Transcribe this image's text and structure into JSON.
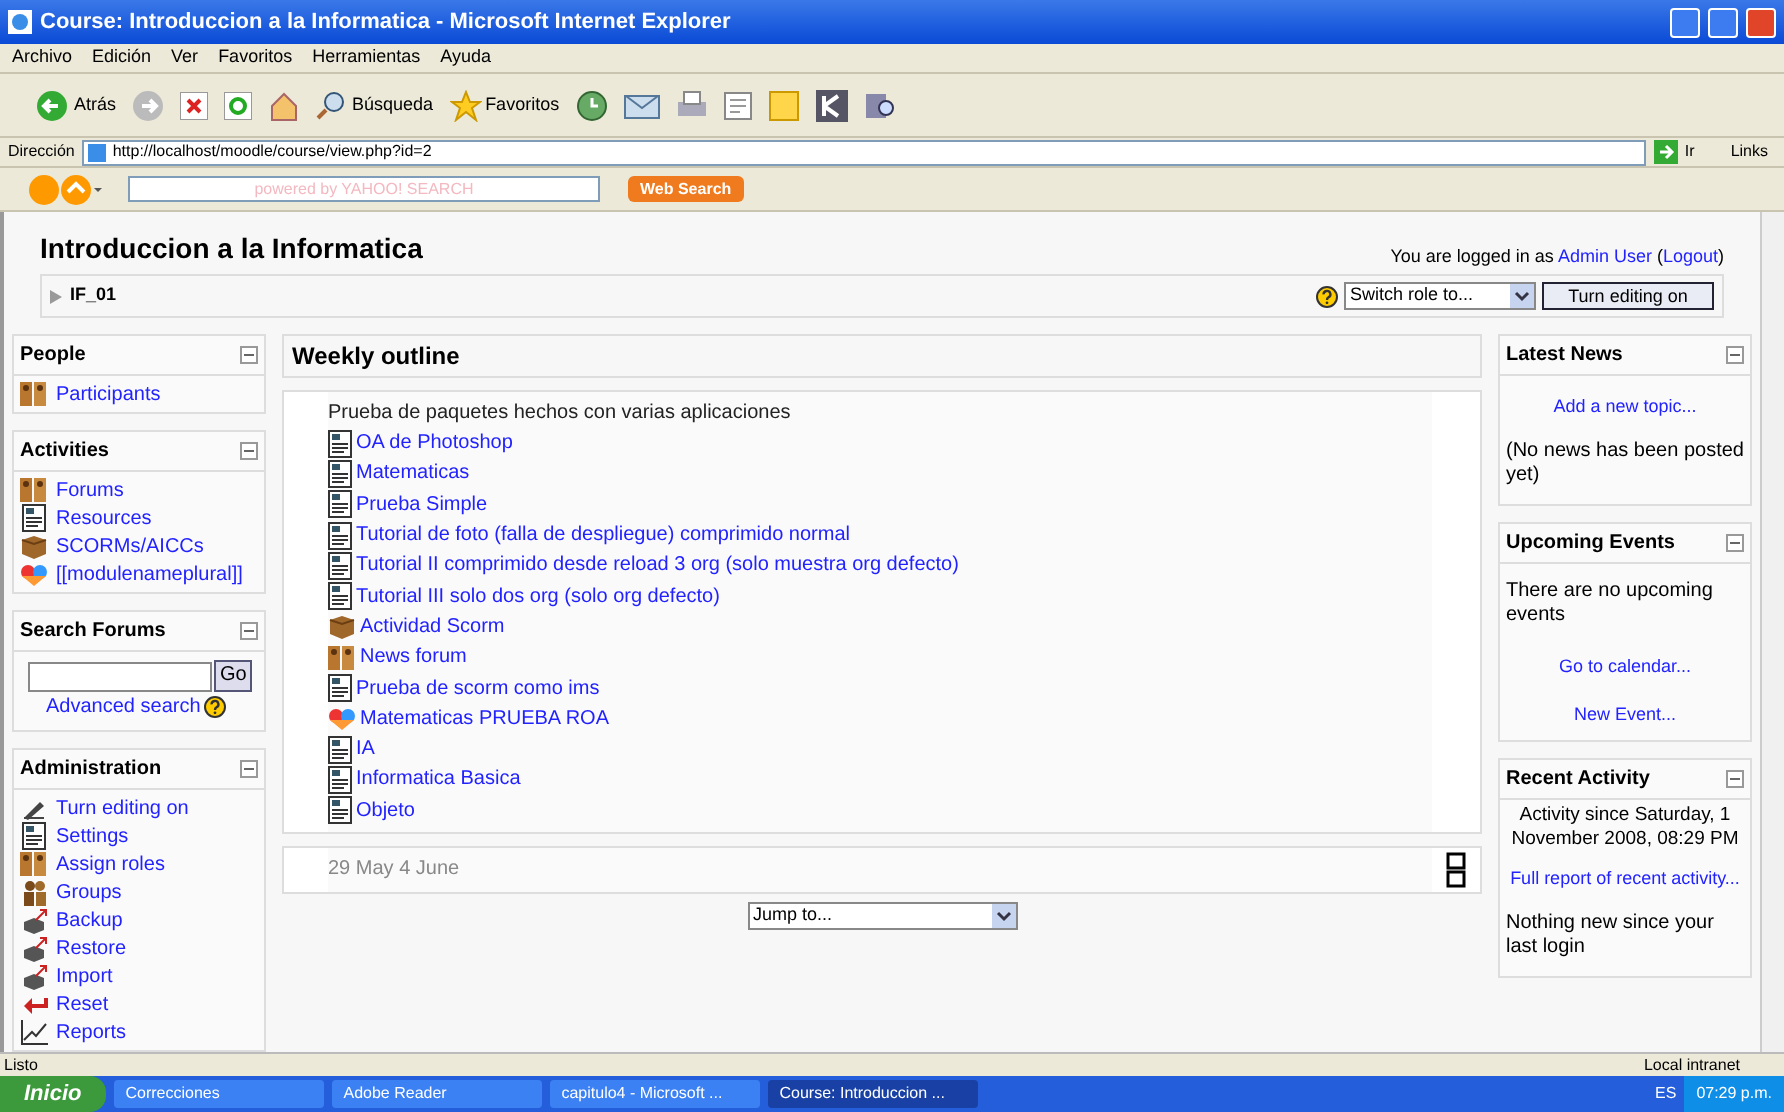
{
  "window": {
    "title": "Course: Introduccion a la Informatica - Microsoft Internet Explorer"
  },
  "menu": [
    "Archivo",
    "Edición",
    "Ver",
    "Favoritos",
    "Herramientas",
    "Ayuda"
  ],
  "toolbar": {
    "back": "Atrás",
    "search": "Búsqueda",
    "favorites": "Favoritos"
  },
  "address": {
    "label": "Dirección",
    "value": "http://localhost/moodle/course/view.php?id=2",
    "go": "Ir",
    "links": "Links"
  },
  "yahoo": {
    "placeholder": "powered by YAHOO! SEARCH",
    "button": "Web Search"
  },
  "page": {
    "title": "Introduccion a la Informatica",
    "login_prefix": "You are logged in as",
    "user": "Admin User",
    "paren_open": "(",
    "logout": "Logout",
    "paren_close": ")",
    "breadcrumb": "IF_01",
    "switch_role": "Switch role to...",
    "edit_button": "Turn editing on"
  },
  "left_blocks": [
    {
      "title": "People",
      "items": [
        {
          "label": "Participants",
          "kind": "people"
        }
      ]
    },
    {
      "title": "Activities",
      "items": [
        {
          "label": "Forums",
          "kind": "forum"
        },
        {
          "label": "Resources",
          "kind": "resource"
        },
        {
          "label": "SCORMs/AICCs",
          "kind": "scorm"
        },
        {
          "label": "[[modulenameplural]]",
          "kind": "roa"
        }
      ]
    },
    {
      "title": "Search Forums",
      "kind": "search",
      "go": "Go",
      "link": "Advanced search"
    },
    {
      "title": "Administration",
      "items": [
        {
          "label": "Turn editing on",
          "kind": "edit"
        },
        {
          "label": "Settings",
          "kind": "resource"
        },
        {
          "label": "Assign roles",
          "kind": "people"
        },
        {
          "label": "Groups",
          "kind": "groups"
        },
        {
          "label": "Backup",
          "kind": "backup"
        },
        {
          "label": "Restore",
          "kind": "backup"
        },
        {
          "label": "Import",
          "kind": "backup"
        },
        {
          "label": "Reset",
          "kind": "reset"
        },
        {
          "label": "Reports",
          "kind": "reports"
        }
      ]
    }
  ],
  "outline": {
    "title": "Weekly outline",
    "summary": "Prueba de paquetes hechos con varias aplicaciones",
    "items": [
      {
        "label": "OA de Photoshop",
        "kind": "resource"
      },
      {
        "label": "Matematicas",
        "kind": "resource"
      },
      {
        "label": "Prueba Simple",
        "kind": "resource"
      },
      {
        "label": "Tutorial de foto (falla de despliegue) comprimido normal",
        "kind": "resource"
      },
      {
        "label": "Tutorial II comprimido desde reload 3 org (solo muestra org defecto)",
        "kind": "resource"
      },
      {
        "label": "Tutorial III solo dos org (solo org defecto)",
        "kind": "resource"
      },
      {
        "label": "Actividad Scorm",
        "kind": "scorm"
      },
      {
        "label": "News forum",
        "kind": "forum"
      },
      {
        "label": "Prueba de scorm como ims",
        "kind": "resource"
      },
      {
        "label": "Matematicas PRUEBA ROA",
        "kind": "roa"
      },
      {
        "label": "IA",
        "kind": "resource"
      },
      {
        "label": "Informatica Basica",
        "kind": "resource"
      },
      {
        "label": "Objeto",
        "kind": "resource"
      }
    ],
    "week": "29 May 4 June",
    "jump": "Jump to..."
  },
  "right_blocks": [
    {
      "title": "Latest News",
      "lines": [
        {
          "text": "Add a new topic...",
          "kind": "link"
        },
        {
          "text": "(No news has been posted yet)",
          "kind": "text"
        }
      ]
    },
    {
      "title": "Upcoming Events",
      "lines": [
        {
          "text": "There are no upcoming events",
          "kind": "text"
        },
        {
          "text": "Go to calendar...",
          "kind": "link"
        },
        {
          "text": "New Event...",
          "kind": "link"
        }
      ]
    },
    {
      "title": "Recent Activity",
      "lines": [
        {
          "text": "Activity since Saturday, 1 November 2008, 08:29 PM",
          "kind": "center"
        },
        {
          "text": "Full report of recent activity...",
          "kind": "link"
        },
        {
          "text": "Nothing new since your last login",
          "kind": "text"
        }
      ]
    }
  ],
  "status_bar": {
    "text": "Listo",
    "zone": "Local intranet"
  },
  "taskbar": {
    "start": "Inicio",
    "tasks": [
      {
        "label": "Correcciones",
        "selected": false
      },
      {
        "label": "Adobe Reader",
        "selected": false
      },
      {
        "label": "capitulo4 - Microsoft ...",
        "selected": false
      },
      {
        "label": "Course: Introduccion ...",
        "selected": true
      }
    ],
    "lang": "ES",
    "clock": "07:29 p.m."
  }
}
